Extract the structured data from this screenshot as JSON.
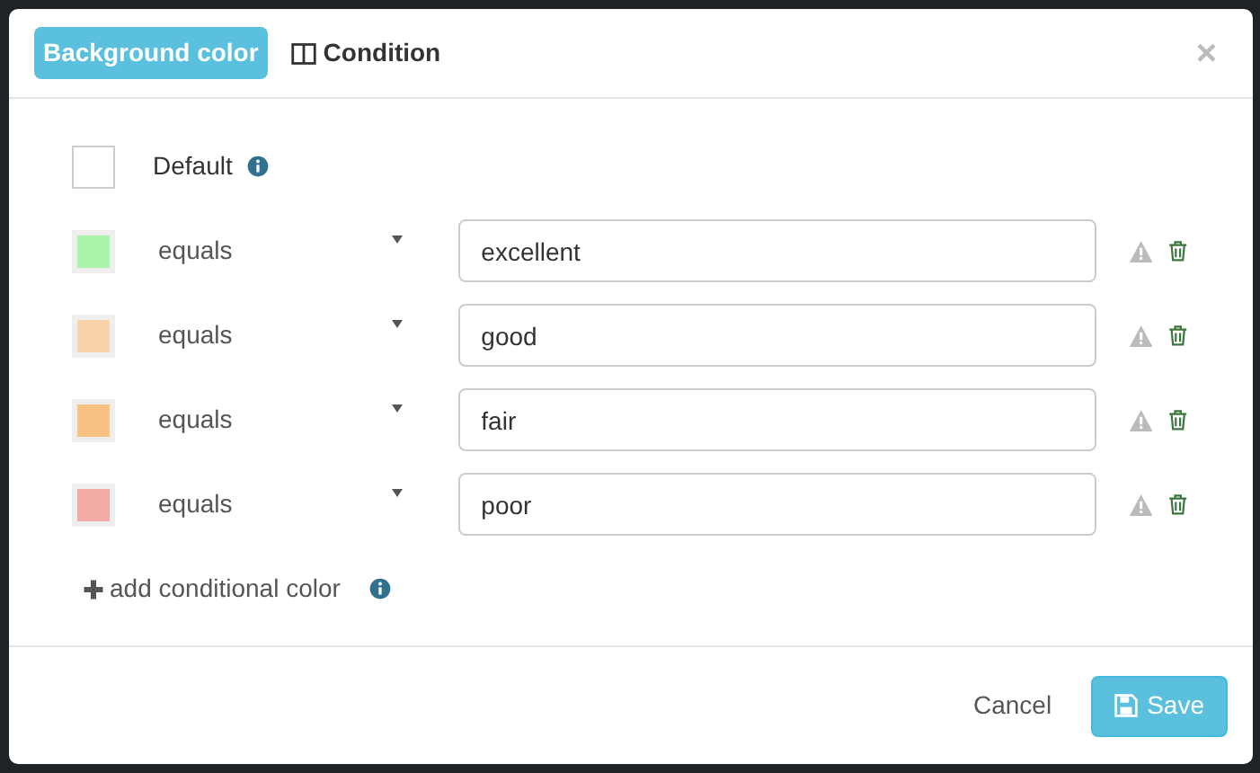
{
  "tabs": [
    {
      "label": "Background color",
      "selected": true
    },
    {
      "label": "Condition",
      "selected": false
    }
  ],
  "close": "×",
  "default": {
    "label": "Default",
    "color": "#ffffff"
  },
  "rules": [
    {
      "color": "#aaf5aa",
      "operator": "equals",
      "value": "excellent"
    },
    {
      "color": "#f8d3ac",
      "operator": "equals",
      "value": "good"
    },
    {
      "color": "#f8c283",
      "operator": "equals",
      "value": "fair"
    },
    {
      "color": "#f3aaa5",
      "operator": "equals",
      "value": "poor"
    }
  ],
  "add_label": "add conditional color",
  "buttons": {
    "cancel": "Cancel",
    "save": "Save"
  }
}
